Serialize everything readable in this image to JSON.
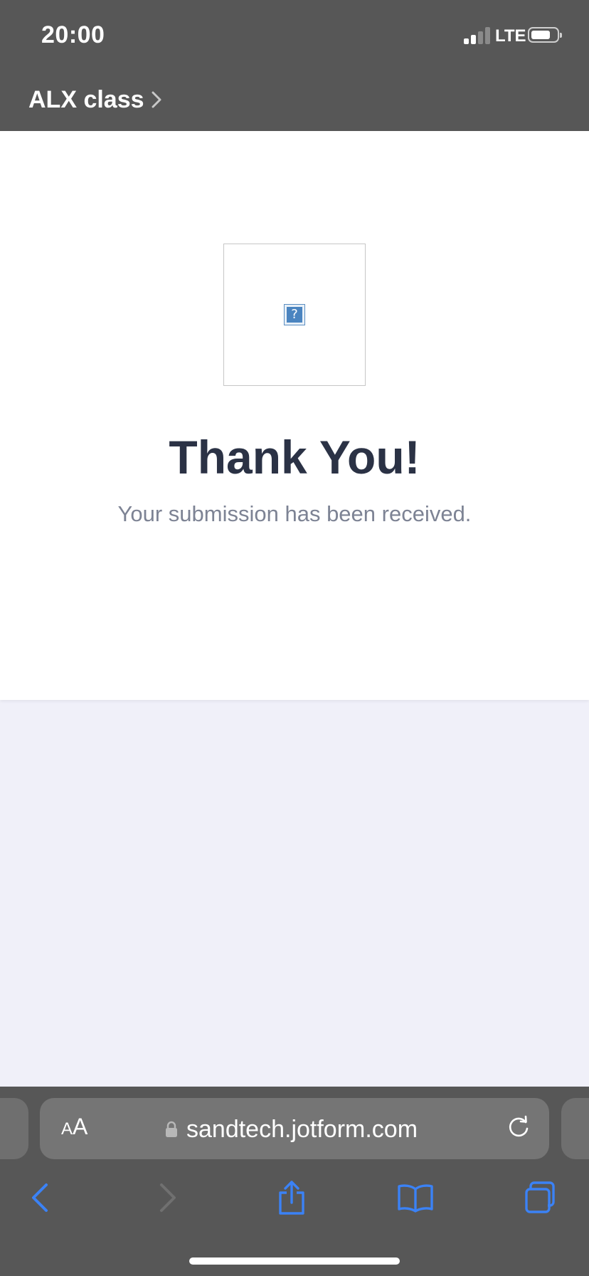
{
  "status_bar": {
    "time": "20:00",
    "network": "LTE"
  },
  "header": {
    "back_app_label": "ALX class"
  },
  "main": {
    "image_icon": "broken-image-icon",
    "broken_image_glyph": "?",
    "title": "Thank You!",
    "subtitle": "Your submission has been received."
  },
  "toolbar": {
    "text_size_small": "A",
    "text_size_large": "A",
    "url": "sandtech.jotform.com"
  },
  "colors": {
    "chrome_background": "#575757",
    "page_background": "#f0f0f9",
    "title_color": "#2b3245",
    "subtitle_color": "#7d8394",
    "accent_blue": "#3b82f6"
  }
}
